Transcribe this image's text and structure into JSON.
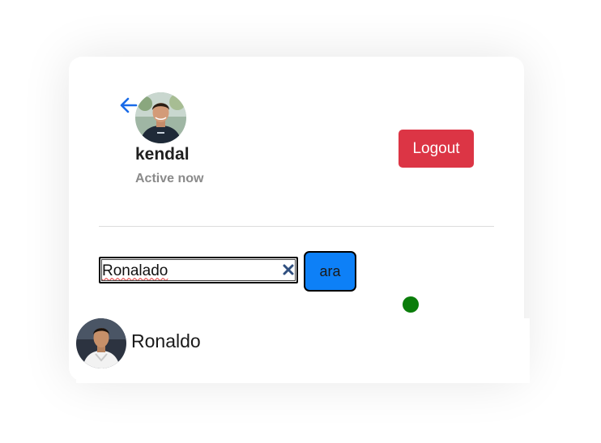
{
  "profile": {
    "username": "kendal",
    "status": "Active now"
  },
  "header": {
    "logout_label": "Logout"
  },
  "search": {
    "value": "Ronalado",
    "button_label": "ara"
  },
  "results": [
    {
      "name": "Ronaldo"
    }
  ],
  "colors": {
    "logout": "#dc3545",
    "search_button": "#0d80f7",
    "online_indicator": "#0a7d0a",
    "back_arrow": "#1a6be8"
  },
  "icons": {
    "back": "arrow-left-icon",
    "clear": "clear-icon"
  }
}
